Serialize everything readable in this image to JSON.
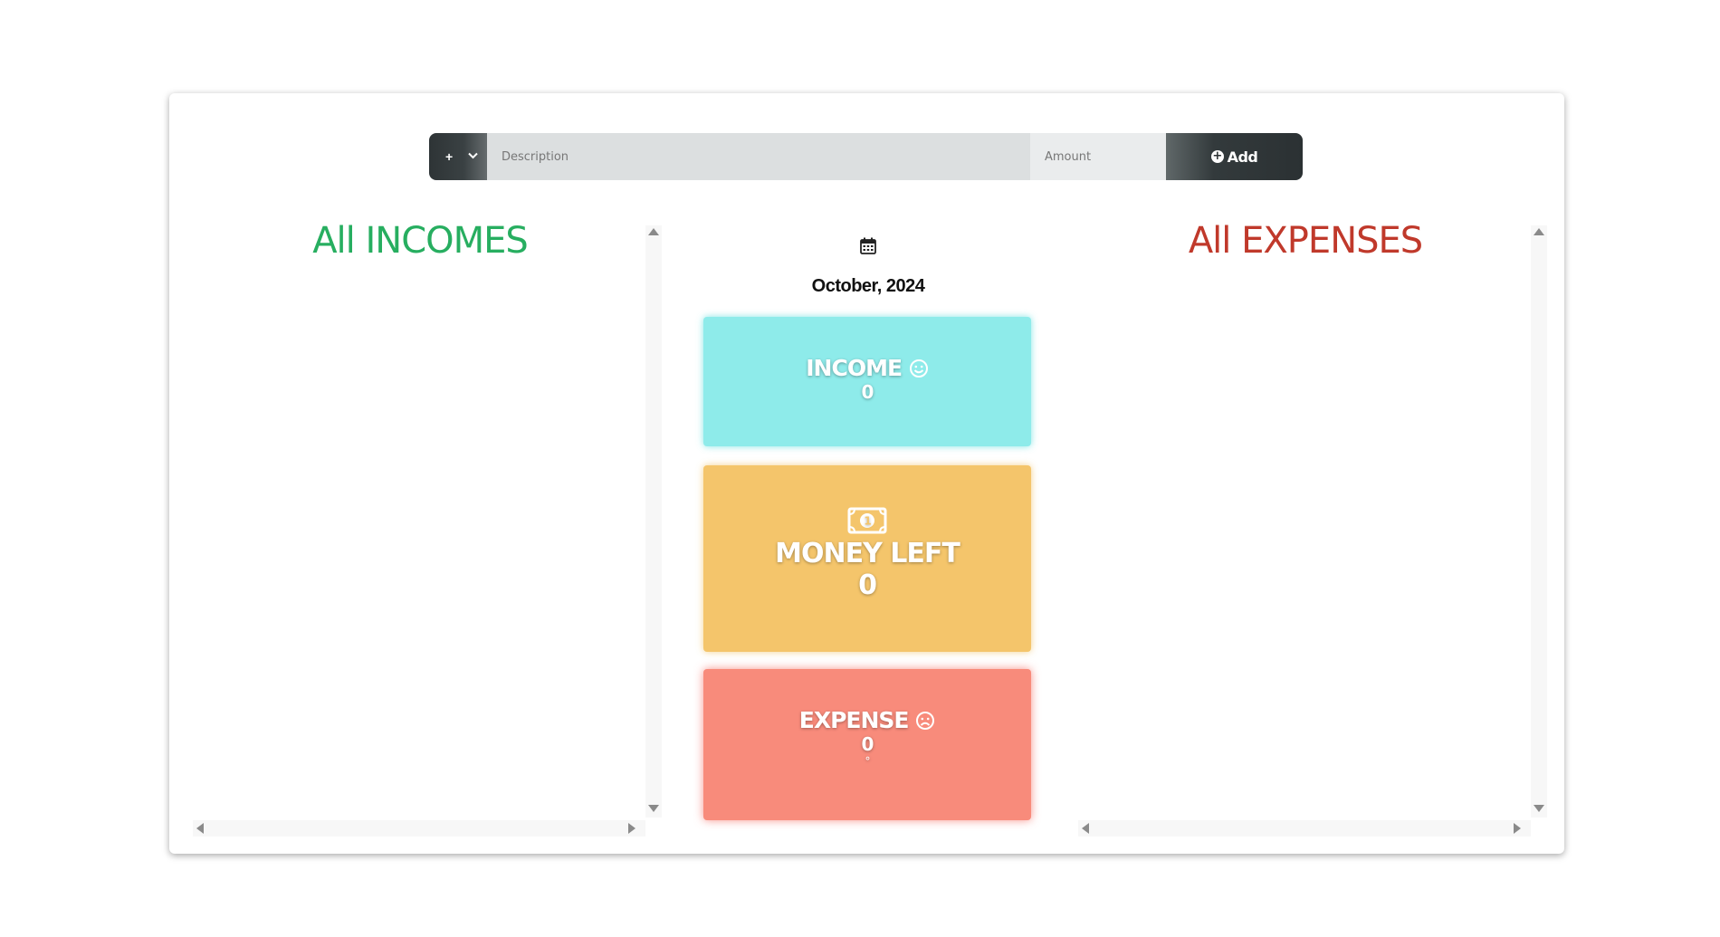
{
  "entry_bar": {
    "type_symbol": "+",
    "description_placeholder": "Description",
    "amount_placeholder": "Amount",
    "add_label": "Add"
  },
  "incomes": {
    "title": "All INCOMES"
  },
  "expenses": {
    "title": "All EXPENSES"
  },
  "summary": {
    "date": "October, 2024",
    "income_label": "INCOME",
    "income_value": "0",
    "money_left_label": "MONEY LEFT",
    "money_left_value": "0",
    "expense_label": "EXPENSE",
    "expense_value": "0",
    "expense_note": "°"
  },
  "icons": {
    "calendar": "calendar-icon",
    "smile": "smile-icon",
    "banknote": "banknote-icon",
    "frown": "frown-icon",
    "add": "plus-circle-icon"
  },
  "colors": {
    "income_title": "#27ae60",
    "expense_title": "#c0392b",
    "income_tile": "#8eebea",
    "money_tile": "#f4c56b",
    "expense_tile": "#f88b7b"
  }
}
